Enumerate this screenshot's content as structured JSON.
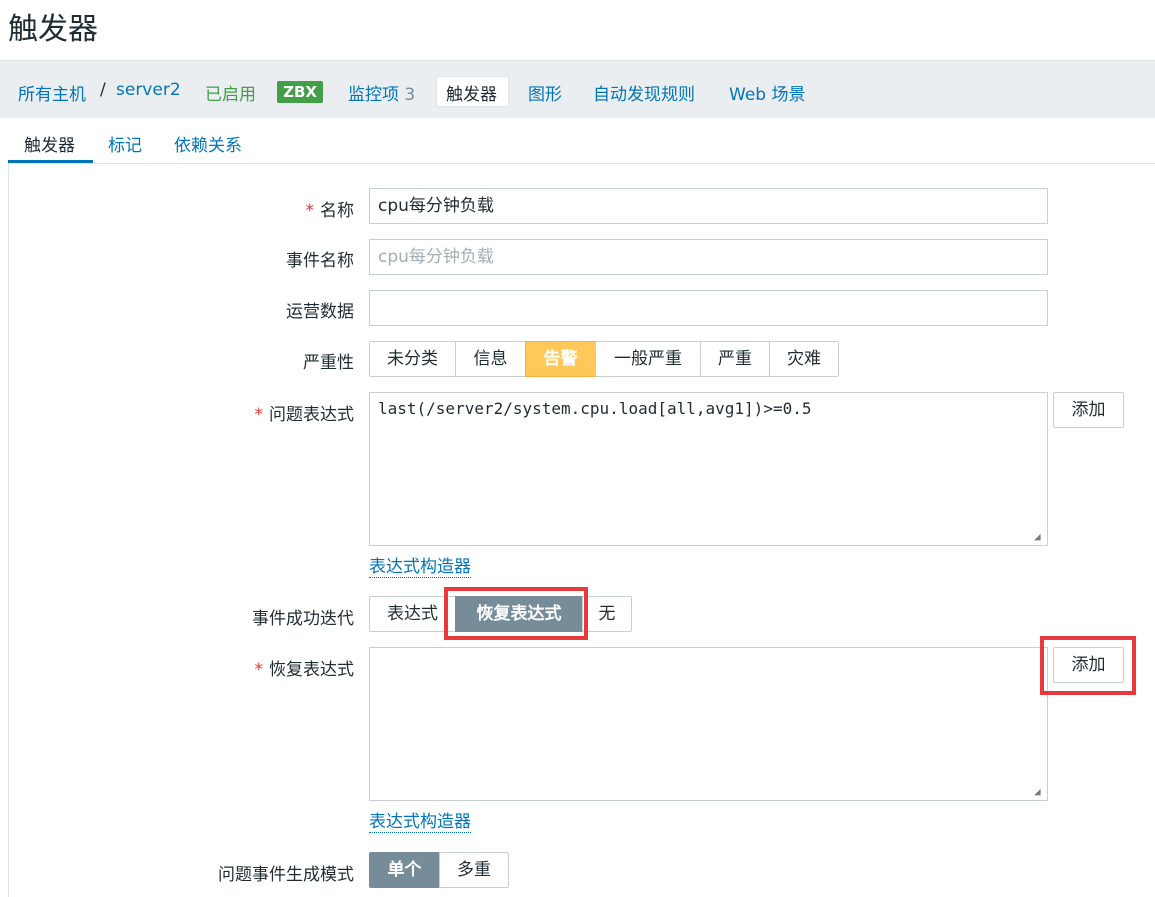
{
  "page": {
    "title": "触发器"
  },
  "breadcrumb": {
    "all_hosts": "所有主机",
    "separator": "/",
    "host": "server2",
    "status": "已启用",
    "badge": "ZBX",
    "items_label": "监控项",
    "items_count": "3",
    "triggers": "触发器",
    "graphs": "图形",
    "discovery": "自动发现规则",
    "web": "Web 场景"
  },
  "tabs": [
    {
      "label": "触发器",
      "active": true
    },
    {
      "label": "标记",
      "active": false
    },
    {
      "label": "依赖关系",
      "active": false
    }
  ],
  "form": {
    "required_mark": "*",
    "name_label": "名称",
    "name_value": "cpu每分钟负载",
    "event_name_label": "事件名称",
    "event_name_placeholder": "cpu每分钟负载",
    "opdata_label": "运营数据",
    "opdata_value": "",
    "severity_label": "严重性",
    "severity_options": [
      "未分类",
      "信息",
      "告警",
      "一般严重",
      "严重",
      "灾难"
    ],
    "severity_selected": "告警",
    "problem_expr_label": "问题表达式",
    "problem_expr_value": "last(/server2/system.cpu.load[all,avg1])>=0.5",
    "add_button": "添加",
    "expr_builder_link": "表达式构造器",
    "recovery_mode_label": "事件成功迭代",
    "recovery_mode_options": [
      "表达式",
      "恢复表达式",
      "无"
    ],
    "recovery_mode_selected": "恢复表达式",
    "recovery_expr_label": "恢复表达式",
    "recovery_expr_value": "",
    "gen_mode_label": "问题事件生成模式",
    "gen_mode_options": [
      "单个",
      "多重"
    ],
    "gen_mode_selected": "单个",
    "resize_glyph": "◢"
  },
  "colors": {
    "link": "#0275b8",
    "enabled": "#429e47",
    "warning": "#ffc859",
    "selected": "#768d99",
    "highlight": "#e8393d"
  }
}
